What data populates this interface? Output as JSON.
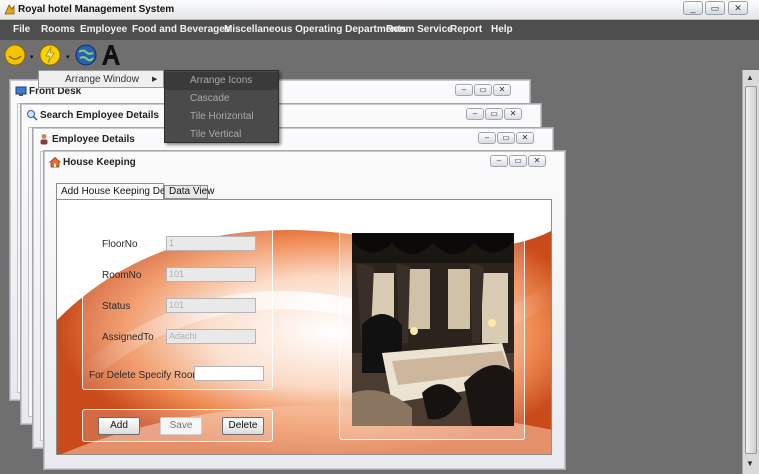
{
  "window": {
    "title": "Royal hotel Management System",
    "controls": [
      "_",
      "▭",
      "✕"
    ]
  },
  "menubar": {
    "items": [
      "File",
      "Rooms",
      "Employee",
      "Food and Beverages",
      "Miscellaneous Operating Departments",
      "Room Service",
      "Report",
      "Help"
    ]
  },
  "toolbar": {
    "icons": [
      "sun-icon",
      "lightning-icon",
      "globe-icon",
      "font-a-icon"
    ]
  },
  "dropdown": {
    "parent_label": "Arrange Window",
    "sub_items": [
      "Arrange Icons",
      "Cascade",
      "Tile Horizontal",
      "Tile Vertical"
    ],
    "highlighted": "Arrange Icons"
  },
  "frames": {
    "front_desk": "Front Desk",
    "search_employee": "Search Employee Details",
    "employee_details": "Employee Details",
    "house_keeping": "House Keeping"
  },
  "house_keeping": {
    "tabs": [
      "Add House Keeping Details",
      "Data View"
    ],
    "active_tab": "Add House Keeping Details",
    "fields": {
      "floor_label": "FloorNo",
      "floor_value": "1",
      "room_label": "RoomNo",
      "room_value": "101",
      "status_label": "Status",
      "status_value": "101",
      "assigned_label": "AssignedTo",
      "assigned_value": "Adachi",
      "delete_label": "For Delete Specify RoomNo",
      "delete_value": ""
    },
    "buttons": {
      "add": "Add",
      "save": "Save",
      "delete": "Delete"
    }
  },
  "colors": {
    "menubar": "#4e4e4e",
    "desktop": "#6f6f6f",
    "accent_orange": "#e86a2c"
  }
}
